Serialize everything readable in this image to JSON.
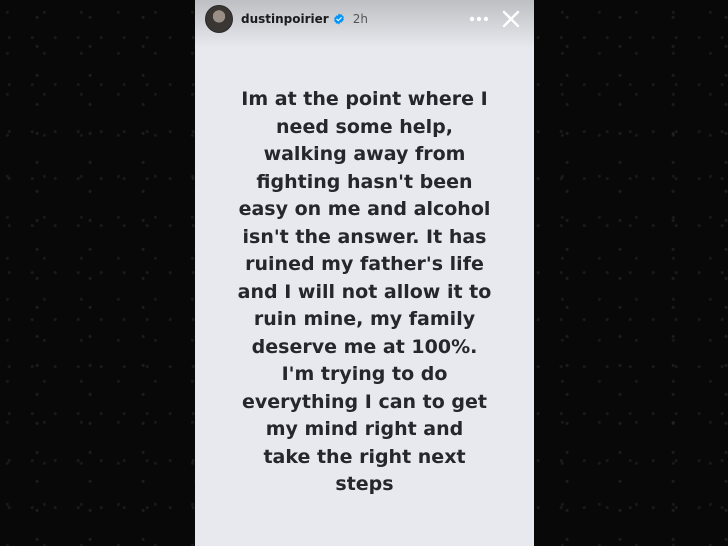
{
  "story": {
    "username": "dustinpoirier",
    "verified": true,
    "time_ago": "2h",
    "icons": {
      "more": "more-horizontal-icon",
      "close": "close-icon",
      "verified": "verified-badge-icon"
    },
    "text": "Im at the point where I\nneed some help,\nwalking away from\nfighting hasn't been\neasy on me and alcohol\nisn't the answer. It has\nruined my father's life\nand I will not allow it to\nruin mine, my family\ndeserve me at 100%.\nI'm trying to do\neverything I can to get\nmy mind right and\ntake the right next\nsteps",
    "background_color": "#e7e9ee",
    "text_color": "#24272c"
  }
}
